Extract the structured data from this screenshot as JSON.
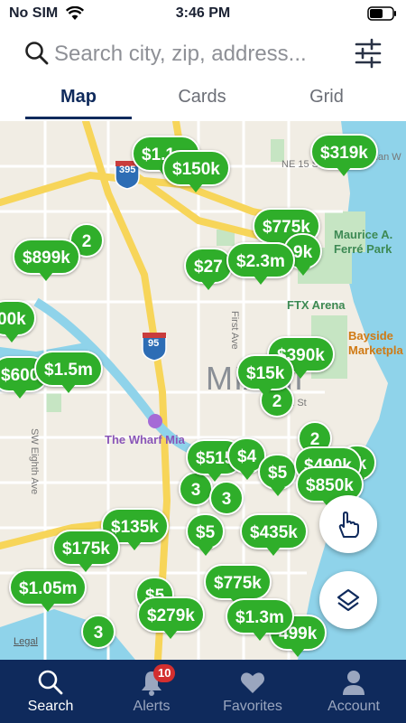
{
  "status_bar": {
    "carrier": "No SIM",
    "time": "3:46 PM"
  },
  "search": {
    "placeholder": "Search city, zip, address..."
  },
  "tabs": [
    {
      "label": "Map",
      "active": true
    },
    {
      "label": "Cards"
    },
    {
      "label": "Grid"
    }
  ],
  "map": {
    "labels": {
      "ne15": "NE 15 St",
      "christian": "stian W",
      "maurice": "Maurice A.",
      "ferre": "Ferré Park",
      "ftx": "FTX Arena",
      "bayside1": "Bayside",
      "bayside2": "Marketpla",
      "miami": "MIAMI",
      "first_ave": "First Ave",
      "s3rd": "S 3rd St",
      "wharf": "The Wharf Mia",
      "sw8": "SW Eighth Ave",
      "i395": "395",
      "i95": "95",
      "legal": "Legal"
    },
    "pins": [
      {
        "label": "$1.1m"
      },
      {
        "label": "$150k"
      },
      {
        "label": "$319k"
      },
      {
        "label": "$775k"
      },
      {
        "label": "$2.3m"
      },
      {
        "label": "$27"
      },
      {
        "label": "9k"
      },
      {
        "label": "$899k"
      },
      {
        "label": "00k"
      },
      {
        "label": "$600"
      },
      {
        "label": "$1.5m"
      },
      {
        "label": "$390k"
      },
      {
        "label": "$15k"
      },
      {
        "label": "$515"
      },
      {
        "label": "$4"
      },
      {
        "label": "$5"
      },
      {
        "label": "$490k"
      },
      {
        "label": "9k"
      },
      {
        "label": "$850k"
      },
      {
        "label": "$135k"
      },
      {
        "label": "$175k"
      },
      {
        "label": "$5"
      },
      {
        "label": "$435k"
      },
      {
        "label": "$1.05m"
      },
      {
        "label": "$775k"
      },
      {
        "label": "$5"
      },
      {
        "label": "$279k"
      },
      {
        "label": "$1.3m"
      },
      {
        "label": "499k"
      }
    ],
    "clusters": [
      {
        "label": "2"
      },
      {
        "label": "2"
      },
      {
        "label": "2"
      },
      {
        "label": "3"
      },
      {
        "label": "3"
      },
      {
        "label": "3"
      }
    ]
  },
  "nav": [
    {
      "label": "Search",
      "active": true,
      "icon": "search-icon"
    },
    {
      "label": "Alerts",
      "badge": "10",
      "icon": "bell-icon"
    },
    {
      "label": "Favorites",
      "icon": "heart-icon"
    },
    {
      "label": "Account",
      "icon": "user-icon"
    }
  ],
  "colors": {
    "pin": "#2fae2a",
    "nav_bg": "#0f2a5c",
    "accent": "#0f2a5c",
    "badge": "#d32f2f"
  }
}
